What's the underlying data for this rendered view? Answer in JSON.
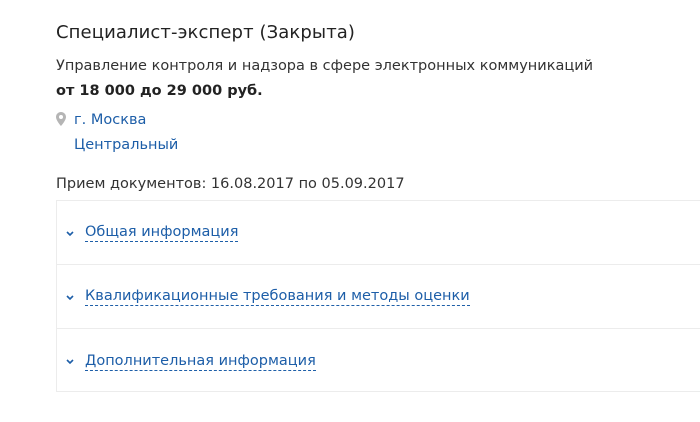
{
  "vacancy": {
    "title": "Специалист-эксперт (Закрыта)",
    "department": "Управление контроля и надзора в сфере электронных коммуникаций",
    "salary": "от 18 000 до 29 000 руб.",
    "location": {
      "icon": "map-pin-icon",
      "city": "г. Москва",
      "district": "Центральный"
    },
    "dates": "Прием документов: 16.08.2017 по 05.09.2017"
  },
  "accordion": {
    "icon": "chevron-down-icon",
    "items": [
      {
        "label": "Общая информация"
      },
      {
        "label": "Квалификационные требования и методы оценки"
      },
      {
        "label": "Дополнительная информация"
      }
    ]
  },
  "colors": {
    "link": "#1d5ea8",
    "text": "#333333",
    "border": "#ececec"
  }
}
